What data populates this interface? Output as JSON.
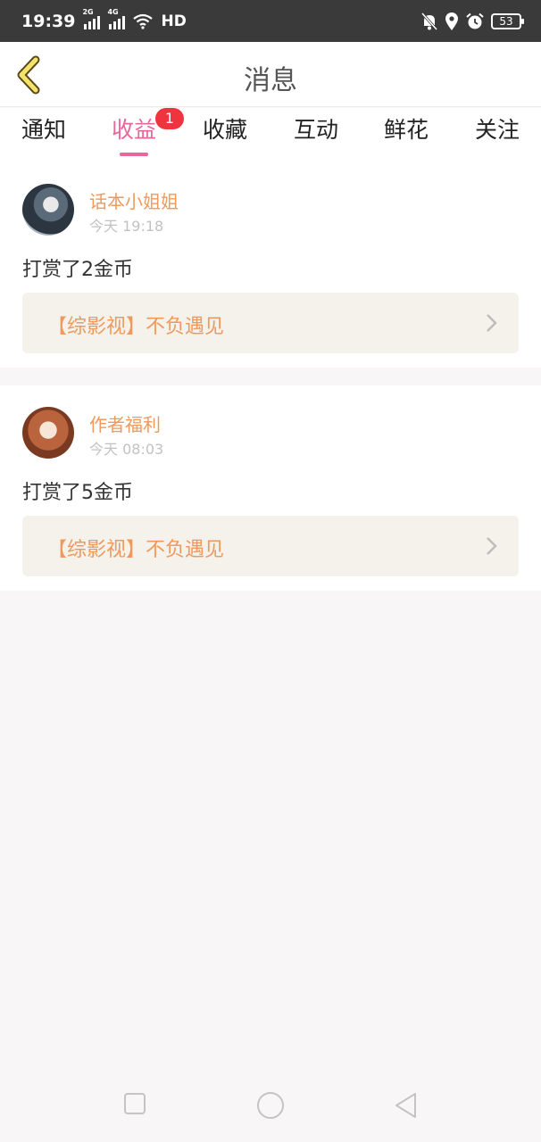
{
  "status_bar": {
    "time": "19:39",
    "net1": "2G",
    "net2": "4G",
    "hd": "HD",
    "battery": "53"
  },
  "header": {
    "title": "消息"
  },
  "tabs": [
    {
      "label": "通知"
    },
    {
      "label": "收益",
      "badge": "1",
      "active": true
    },
    {
      "label": "收藏"
    },
    {
      "label": "互动"
    },
    {
      "label": "鲜花"
    },
    {
      "label": "关注"
    }
  ],
  "messages": [
    {
      "name": "话本小姐姐",
      "time": "今天 19:18",
      "text": "打赏了2金币",
      "book": "【综影视】不负遇见"
    },
    {
      "name": "作者福利",
      "time": "今天 08:03",
      "text": "打赏了5金币",
      "book": "【综影视】不负遇见"
    }
  ],
  "colors": {
    "accent": "#e8669a",
    "name": "#ee9a5e",
    "badge": "#f0343f"
  }
}
